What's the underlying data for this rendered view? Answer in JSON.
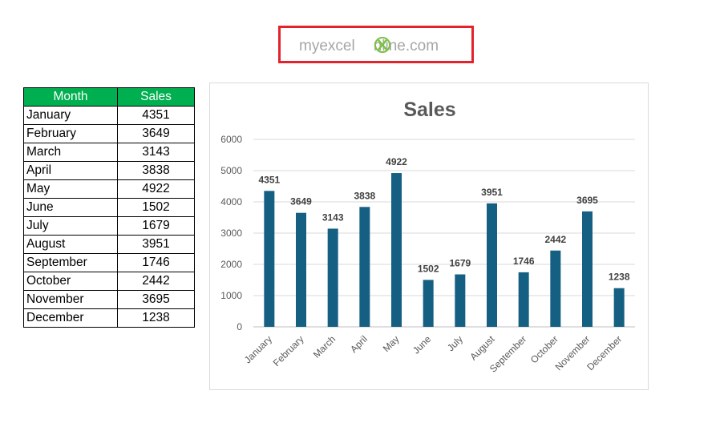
{
  "logo": {
    "part_my": "my",
    "part_excel": "excel",
    "part_rest": "nline",
    "part_domain": ".com",
    "colors": {
      "grey": "#a6a6a6",
      "green": "#7ac143",
      "frame": "#e3232c"
    }
  },
  "table": {
    "headers": [
      "Month",
      "Sales"
    ],
    "rows": [
      [
        "January",
        "4351"
      ],
      [
        "February",
        "3649"
      ],
      [
        "March",
        "3143"
      ],
      [
        "April",
        "3838"
      ],
      [
        "May",
        "4922"
      ],
      [
        "June",
        "1502"
      ],
      [
        "July",
        "1679"
      ],
      [
        "August",
        "3951"
      ],
      [
        "September",
        "1746"
      ],
      [
        "October",
        "2442"
      ],
      [
        "November",
        "3695"
      ],
      [
        "December",
        "1238"
      ]
    ],
    "header_color": "#00b050"
  },
  "chart_data": {
    "type": "bar",
    "title": "Sales",
    "categories": [
      "January",
      "February",
      "March",
      "April",
      "May",
      "June",
      "July",
      "August",
      "September",
      "October",
      "November",
      "December"
    ],
    "values": [
      4351,
      3649,
      3143,
      3838,
      4922,
      1502,
      1679,
      3951,
      1746,
      2442,
      3695,
      1238
    ],
    "yticks": [
      0,
      1000,
      2000,
      3000,
      4000,
      5000,
      6000
    ],
    "ylim": [
      0,
      6000
    ],
    "grid": true,
    "legend": "none",
    "bar_color": "#156082",
    "data_labels": true
  }
}
